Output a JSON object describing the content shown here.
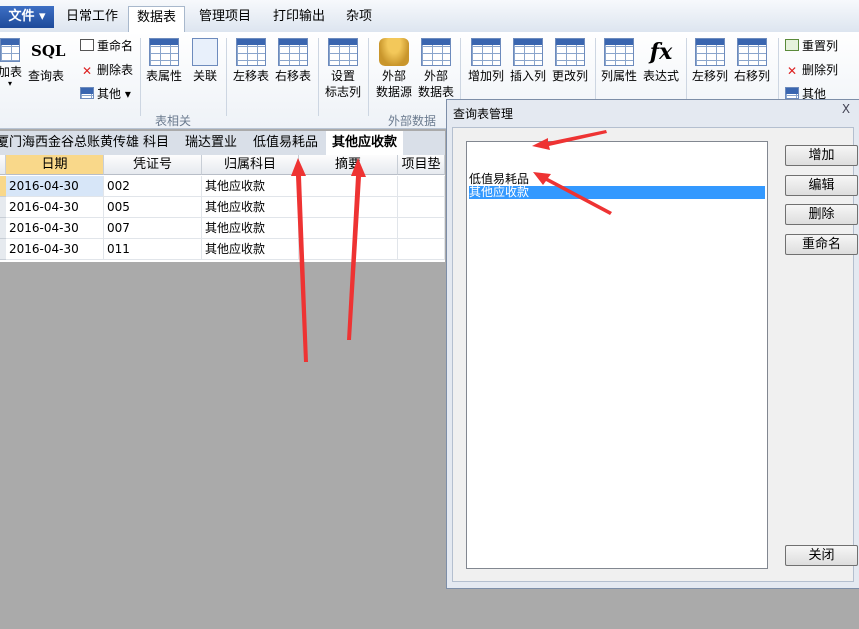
{
  "menu": {
    "file": "文件",
    "tabs": [
      "日常工作",
      "数据表",
      "管理项目",
      "打印输出",
      "杂项"
    ]
  },
  "ribbon": {
    "btn_add_table": "加表",
    "btn_query_table": "查询表",
    "sql_label": "SQL",
    "btn_rename": "重命名",
    "btn_delete_table": "删除表",
    "btn_other": "其他",
    "btn_table_props": "表属性",
    "btn_relate": "关联",
    "btn_move_table_left": "左移表",
    "btn_move_table_right": "右移表",
    "btn_set_flag_col_1": "设置",
    "btn_set_flag_col_2": "标志列",
    "group_table": "表相关",
    "btn_ext_source_1": "外部",
    "btn_ext_source_2": "数据源",
    "btn_ext_table_1": "外部",
    "btn_ext_table_2": "数据表",
    "group_external": "外部数据",
    "btn_add_col": "增加列",
    "btn_insert_col": "插入列",
    "btn_change_col": "更改列",
    "btn_col_props": "列属性",
    "btn_expression": "表达式",
    "btn_move_col_left": "左移列",
    "btn_move_col_right": "右移列",
    "btn_reset_col": "重置列",
    "btn_delete_col": "删除列",
    "btn_other2": "其他"
  },
  "sheet_tabs": [
    "厦门海西金谷总账黄传雄",
    "科目",
    "瑞达置业",
    "低值易耗品",
    "其他应收款"
  ],
  "table": {
    "headers": [
      "日期",
      "凭证号",
      "归属科目",
      "摘要",
      "项目垫"
    ],
    "rows": [
      [
        "2016-04-30",
        "002",
        "其他应收款",
        ""
      ],
      [
        "2016-04-30",
        "005",
        "其他应收款",
        ""
      ],
      [
        "2016-04-30",
        "007",
        "其他应收款",
        ""
      ],
      [
        "2016-04-30",
        "011",
        "其他应收款",
        ""
      ]
    ]
  },
  "dialog": {
    "title": "查询表管理",
    "close_glyph": "X",
    "items": [
      "低值易耗品",
      "其他应收款"
    ],
    "selected_index": 1,
    "buttons": {
      "add": "增加",
      "edit": "编辑",
      "delete": "删除",
      "rename": "重命名",
      "close": "关闭"
    }
  },
  "colors": {
    "annotation_arrow": "#ee3333",
    "selection": "#3399ff",
    "header_selected": "#f9d88a"
  }
}
